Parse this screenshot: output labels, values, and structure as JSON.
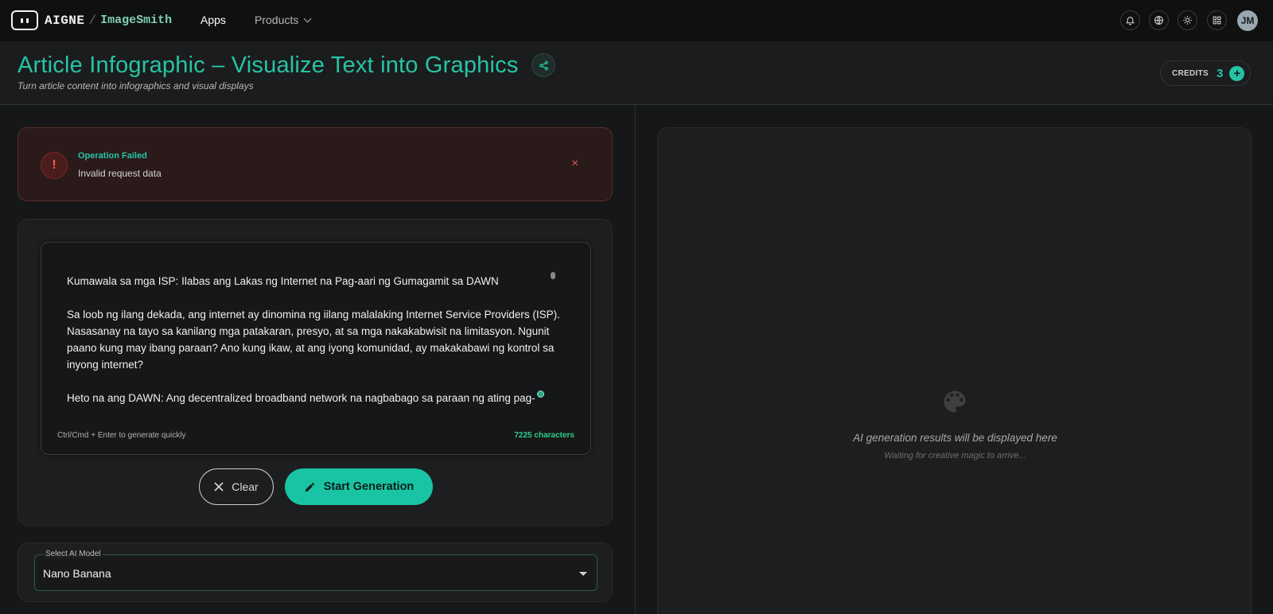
{
  "nav": {
    "brand": "AIGNE",
    "separator": "/",
    "product": "ImageSmith",
    "apps_label": "Apps",
    "products_label": "Products",
    "icons": [
      "bell-icon",
      "globe-icon",
      "sun-icon",
      "grid-icon"
    ],
    "avatar_initials": "JM"
  },
  "header": {
    "title": "Article Infographic – Visualize Text into Graphics",
    "subtitle": "Turn article content into infographics and visual displays",
    "credits_label": "CREDITS",
    "credits_value": "3",
    "credits_add": "+"
  },
  "alert": {
    "icon": "!",
    "title": "Operation Failed",
    "message": "Invalid request data",
    "close": "×"
  },
  "editor": {
    "paragraphs": [
      "Kumawala sa mga ISP: Ilabas ang Lakas ng Internet na Pag-aari ng Gumagamit sa DAWN",
      "Sa loob ng ilang dekada, ang internet ay dinomina ng iilang malalaking Internet Service Providers (ISP). Nasasanay na tayo sa kanilang mga patakaran, presyo, at sa mga nakakabwisit na limitasyon. Ngunit paano kung may ibang paraan? Ano kung ikaw, at ang iyong komunidad, ay makakabawi ng kontrol sa inyong internet?",
      "Heto na ang DAWN: Ang decentralized broadband network na nagbabago sa paraan ng ating pag-"
    ],
    "hint": "Ctrl/Cmd + Enter to generate quickly",
    "char_count": "7225 characters",
    "clear_label": "Clear",
    "generate_label": "Start Generation"
  },
  "model": {
    "label": "Select AI Model",
    "value": "Nano Banana"
  },
  "result": {
    "title": "AI generation results will be displayed here",
    "subtitle": "Waiting for creative magic to arrive..."
  }
}
